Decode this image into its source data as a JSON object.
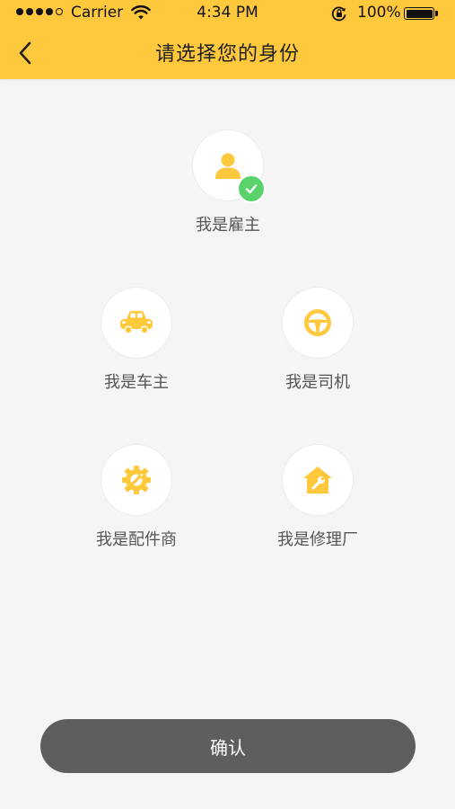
{
  "status_bar": {
    "carrier": "Carrier",
    "time": "4:34 PM",
    "battery": "100%"
  },
  "header": {
    "title": "请选择您的身份",
    "back_icon": "chevron-left-icon"
  },
  "roles": [
    {
      "label": "我是雇主",
      "icon": "person-icon",
      "selected": true
    },
    {
      "label": "我是车主",
      "icon": "car-icon",
      "selected": false
    },
    {
      "label": "我是司机",
      "icon": "steering-wheel-icon",
      "selected": false
    },
    {
      "label": "我是配件商",
      "icon": "gear-wrench-icon",
      "selected": false
    },
    {
      "label": "我是修理厂",
      "icon": "house-wrench-icon",
      "selected": false
    }
  ],
  "confirm_label": "确认",
  "colors": {
    "brand": "#ffc83d",
    "selected_check": "#5bd36b",
    "button": "#5e5e5e",
    "background": "#f5f5f5"
  }
}
